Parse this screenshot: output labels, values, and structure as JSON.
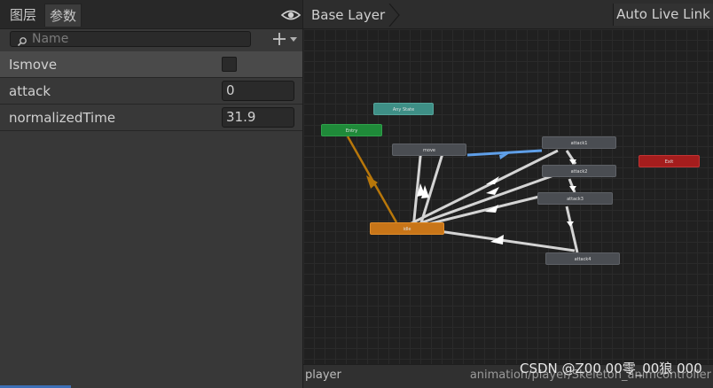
{
  "tabs": {
    "layers": "图层",
    "params": "参数"
  },
  "icons": {
    "eye": "eye-icon",
    "search": "search-icon",
    "add": "plus-icon",
    "dropdown": "chevron-down-icon"
  },
  "search": {
    "placeholder": "Name"
  },
  "parameters": [
    {
      "name": "Ismove",
      "type": "bool",
      "value": false
    },
    {
      "name": "attack",
      "type": "int",
      "value": "0"
    },
    {
      "name": "normalizedTime",
      "type": "float",
      "value": "31.9"
    }
  ],
  "graph": {
    "breadcrumb": "Base Layer",
    "live_link": "Auto Live Link",
    "nodes": {
      "any_state": "Any State",
      "entry": "Entry",
      "exit": "Exit",
      "move": "move",
      "idle": "idle",
      "attack1": "attack1",
      "attack2": "attack2",
      "attack3": "attack3",
      "attack4": "attack4"
    }
  },
  "status": {
    "controller": "player",
    "path": "animation/player/Skeleton_animcontroller"
  },
  "watermark": "CSDN @Z00 00零_00狼 000",
  "colors": {
    "panel": "#383838",
    "selected_row": "#4a4a4a",
    "graph_bg": "#202020",
    "any_state": "#3e8f86",
    "entry": "#1f8a39",
    "exit": "#a51d1d",
    "default_state": "#c87518",
    "transition": "#d4d4d4",
    "entry_transition": "#b8770a",
    "active_transition": "#5f9fe8"
  }
}
